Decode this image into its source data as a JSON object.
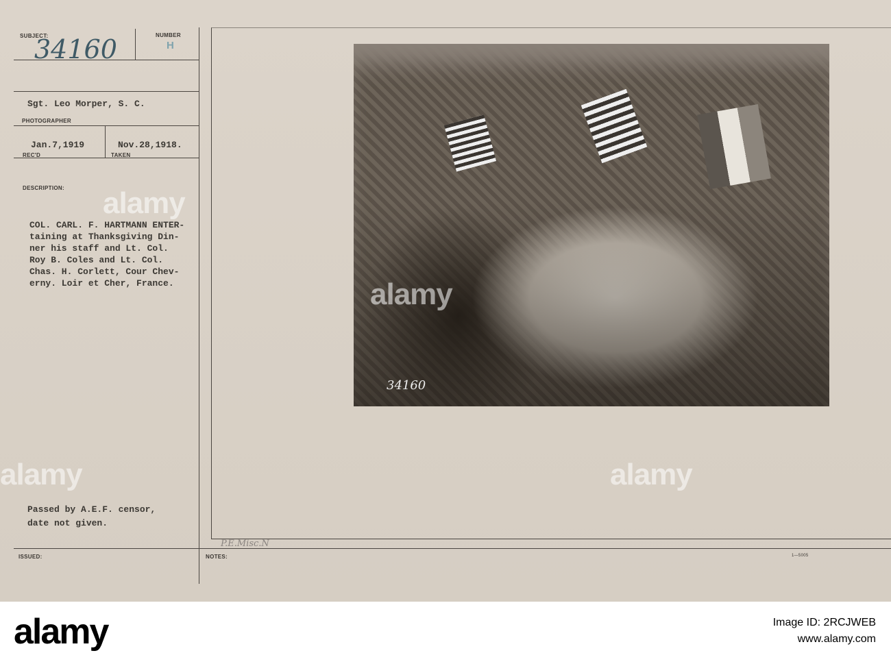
{
  "card": {
    "subject_label": "SUBJECT:",
    "subject_value": "34160",
    "number_label": "NUMBER",
    "number_value": "H",
    "photographer": "Sgt. Leo Morper, S. C.",
    "photographer_label": "PHOTOGRAPHER",
    "received": "Jan.7,1919",
    "received_label": "REC'D",
    "taken": "Nov.28,1918.",
    "taken_label": "TAKEN",
    "description_label": "DESCRIPTION:",
    "description_lines": [
      "COL. CARL. F. HARTMANN ENTER-",
      "taining at Thanksgiving Din-",
      "ner his staff and Lt. Col.",
      "Roy B. Coles and Lt. Col.",
      "Chas. H. Corlett, Cour Chev-",
      "erny. Loir et Cher, France."
    ],
    "censor_lines": [
      "Passed by A.E.F. censor,",
      "date not given."
    ],
    "issued_label": "ISSUED:",
    "notes_label": "NOTES:",
    "pencil_note": "P.E.Misc.N",
    "form_number": "1—5005",
    "photo_stamp": "34160"
  },
  "watermark": "alamy",
  "banner": {
    "logo": "alamy",
    "image_id": "Image ID: 2RCJWEB",
    "url": "www.alamy.com"
  }
}
